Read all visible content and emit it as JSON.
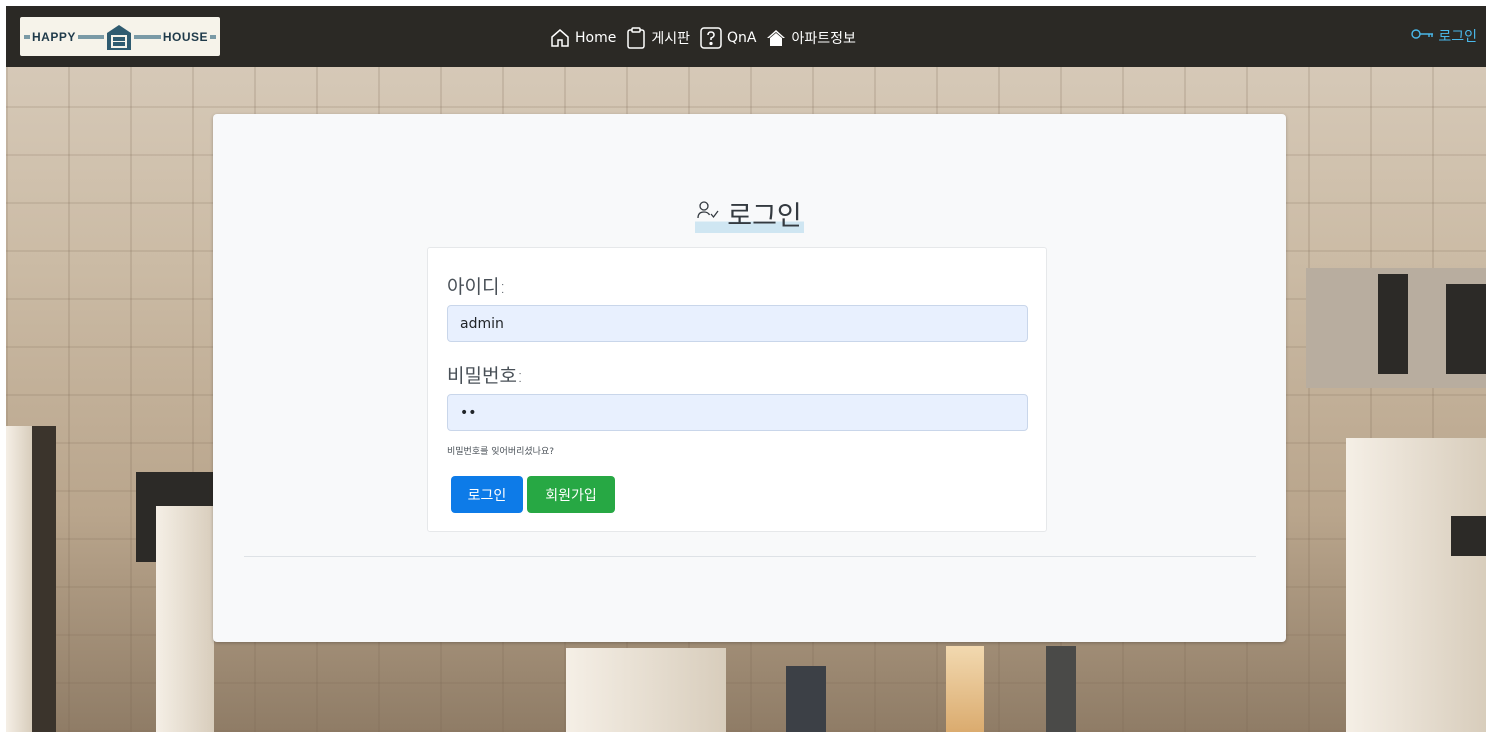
{
  "brand": {
    "left_word": "HAPPY",
    "right_word": "HOUSE",
    "logo_icon": "house-logo-icon"
  },
  "nav": {
    "items": [
      {
        "label": "Home",
        "icon": "home-icon"
      },
      {
        "label": "게시판",
        "icon": "clipboard-icon"
      },
      {
        "label": "QnA",
        "icon": "question-icon"
      },
      {
        "label": "아파트정보",
        "icon": "house-icon"
      }
    ],
    "login_label": "로그인",
    "login_icon": "key-icon"
  },
  "login": {
    "title": "로그인",
    "title_icon": "person-check-icon",
    "id_label": "아이디:",
    "id_value": "admin",
    "pw_label": "비밀번호:",
    "pw_value": "ab",
    "forgot_label": "비밀번호를 잊어버리셨나요?",
    "login_button": "로그인",
    "signup_button": "회원가입"
  },
  "colors": {
    "navbar": "#2b2925",
    "nav_login": "#4ab8ea",
    "primary": "#0d7be8",
    "success": "#27a844",
    "input_bg": "#e8f0fe"
  }
}
